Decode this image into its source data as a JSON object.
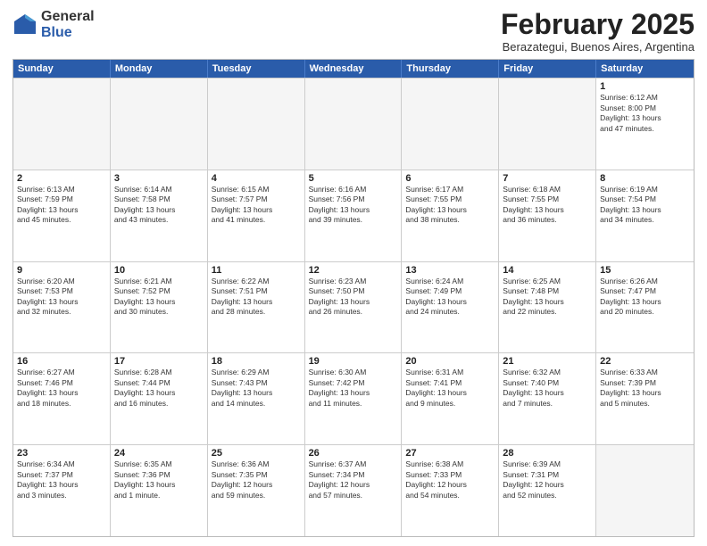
{
  "logo": {
    "general": "General",
    "blue": "Blue"
  },
  "title": "February 2025",
  "location": "Berazategui, Buenos Aires, Argentina",
  "header_days": [
    "Sunday",
    "Monday",
    "Tuesday",
    "Wednesday",
    "Thursday",
    "Friday",
    "Saturday"
  ],
  "rows": [
    [
      {
        "day": "",
        "text": "",
        "empty": true
      },
      {
        "day": "",
        "text": "",
        "empty": true
      },
      {
        "day": "",
        "text": "",
        "empty": true
      },
      {
        "day": "",
        "text": "",
        "empty": true
      },
      {
        "day": "",
        "text": "",
        "empty": true
      },
      {
        "day": "",
        "text": "",
        "empty": true
      },
      {
        "day": "1",
        "text": "Sunrise: 6:12 AM\nSunset: 8:00 PM\nDaylight: 13 hours\nand 47 minutes.",
        "empty": false
      }
    ],
    [
      {
        "day": "2",
        "text": "Sunrise: 6:13 AM\nSunset: 7:59 PM\nDaylight: 13 hours\nand 45 minutes.",
        "empty": false
      },
      {
        "day": "3",
        "text": "Sunrise: 6:14 AM\nSunset: 7:58 PM\nDaylight: 13 hours\nand 43 minutes.",
        "empty": false
      },
      {
        "day": "4",
        "text": "Sunrise: 6:15 AM\nSunset: 7:57 PM\nDaylight: 13 hours\nand 41 minutes.",
        "empty": false
      },
      {
        "day": "5",
        "text": "Sunrise: 6:16 AM\nSunset: 7:56 PM\nDaylight: 13 hours\nand 39 minutes.",
        "empty": false
      },
      {
        "day": "6",
        "text": "Sunrise: 6:17 AM\nSunset: 7:55 PM\nDaylight: 13 hours\nand 38 minutes.",
        "empty": false
      },
      {
        "day": "7",
        "text": "Sunrise: 6:18 AM\nSunset: 7:55 PM\nDaylight: 13 hours\nand 36 minutes.",
        "empty": false
      },
      {
        "day": "8",
        "text": "Sunrise: 6:19 AM\nSunset: 7:54 PM\nDaylight: 13 hours\nand 34 minutes.",
        "empty": false
      }
    ],
    [
      {
        "day": "9",
        "text": "Sunrise: 6:20 AM\nSunset: 7:53 PM\nDaylight: 13 hours\nand 32 minutes.",
        "empty": false
      },
      {
        "day": "10",
        "text": "Sunrise: 6:21 AM\nSunset: 7:52 PM\nDaylight: 13 hours\nand 30 minutes.",
        "empty": false
      },
      {
        "day": "11",
        "text": "Sunrise: 6:22 AM\nSunset: 7:51 PM\nDaylight: 13 hours\nand 28 minutes.",
        "empty": false
      },
      {
        "day": "12",
        "text": "Sunrise: 6:23 AM\nSunset: 7:50 PM\nDaylight: 13 hours\nand 26 minutes.",
        "empty": false
      },
      {
        "day": "13",
        "text": "Sunrise: 6:24 AM\nSunset: 7:49 PM\nDaylight: 13 hours\nand 24 minutes.",
        "empty": false
      },
      {
        "day": "14",
        "text": "Sunrise: 6:25 AM\nSunset: 7:48 PM\nDaylight: 13 hours\nand 22 minutes.",
        "empty": false
      },
      {
        "day": "15",
        "text": "Sunrise: 6:26 AM\nSunset: 7:47 PM\nDaylight: 13 hours\nand 20 minutes.",
        "empty": false
      }
    ],
    [
      {
        "day": "16",
        "text": "Sunrise: 6:27 AM\nSunset: 7:46 PM\nDaylight: 13 hours\nand 18 minutes.",
        "empty": false
      },
      {
        "day": "17",
        "text": "Sunrise: 6:28 AM\nSunset: 7:44 PM\nDaylight: 13 hours\nand 16 minutes.",
        "empty": false
      },
      {
        "day": "18",
        "text": "Sunrise: 6:29 AM\nSunset: 7:43 PM\nDaylight: 13 hours\nand 14 minutes.",
        "empty": false
      },
      {
        "day": "19",
        "text": "Sunrise: 6:30 AM\nSunset: 7:42 PM\nDaylight: 13 hours\nand 11 minutes.",
        "empty": false
      },
      {
        "day": "20",
        "text": "Sunrise: 6:31 AM\nSunset: 7:41 PM\nDaylight: 13 hours\nand 9 minutes.",
        "empty": false
      },
      {
        "day": "21",
        "text": "Sunrise: 6:32 AM\nSunset: 7:40 PM\nDaylight: 13 hours\nand 7 minutes.",
        "empty": false
      },
      {
        "day": "22",
        "text": "Sunrise: 6:33 AM\nSunset: 7:39 PM\nDaylight: 13 hours\nand 5 minutes.",
        "empty": false
      }
    ],
    [
      {
        "day": "23",
        "text": "Sunrise: 6:34 AM\nSunset: 7:37 PM\nDaylight: 13 hours\nand 3 minutes.",
        "empty": false
      },
      {
        "day": "24",
        "text": "Sunrise: 6:35 AM\nSunset: 7:36 PM\nDaylight: 13 hours\nand 1 minute.",
        "empty": false
      },
      {
        "day": "25",
        "text": "Sunrise: 6:36 AM\nSunset: 7:35 PM\nDaylight: 12 hours\nand 59 minutes.",
        "empty": false
      },
      {
        "day": "26",
        "text": "Sunrise: 6:37 AM\nSunset: 7:34 PM\nDaylight: 12 hours\nand 57 minutes.",
        "empty": false
      },
      {
        "day": "27",
        "text": "Sunrise: 6:38 AM\nSunset: 7:33 PM\nDaylight: 12 hours\nand 54 minutes.",
        "empty": false
      },
      {
        "day": "28",
        "text": "Sunrise: 6:39 AM\nSunset: 7:31 PM\nDaylight: 12 hours\nand 52 minutes.",
        "empty": false
      },
      {
        "day": "",
        "text": "",
        "empty": true
      }
    ]
  ]
}
